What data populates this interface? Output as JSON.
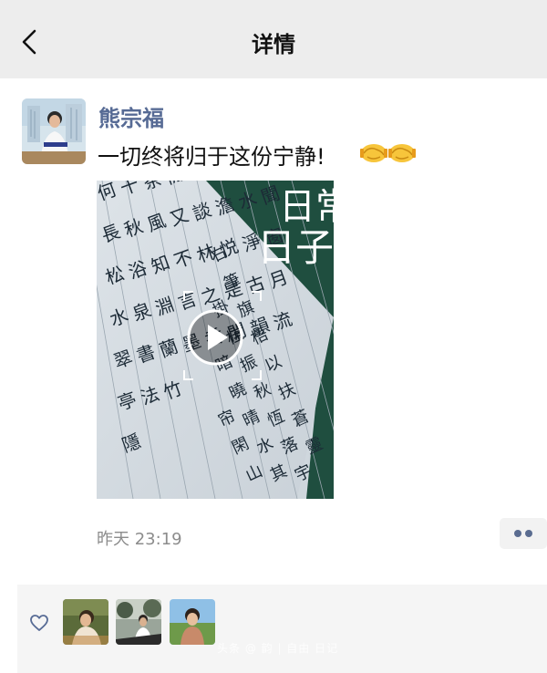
{
  "nav": {
    "title": "详情",
    "back_icon": "chevron-left-icon"
  },
  "post": {
    "username": "熊宗福",
    "text": "一切终将归于这份宁静!",
    "emoji": "handshake-emoji",
    "timestamp": "昨天 23:19",
    "video": {
      "overlay_title": "日常\n日子",
      "play_icon": "play-icon",
      "calligraphy_columns": [
        "何長松水翠亭隱",
        "十秋浴泉書法",
        "茶風知淵蘭竹",
        "閒又不言墨",
        "觀談林之香",
        "清澹悦是閒",
        "心水淨古韻",
        "時聞窗月流"
      ],
      "sheet_columns": [
        "右掛暗帘",
        "筆桂曉閑",
        "旗振晴山",
        "梧秋水天",
        "以恆其時",
        "扶落將美",
        "蒼宇夢松",
        "靈雁神"
      ]
    }
  },
  "colors": {
    "nav_bg": "#ededed",
    "username": "#576b95",
    "timestamp": "#8c8c8c",
    "likes_bg": "#f5f5f5",
    "video_green": "#1f4e3f"
  },
  "likes": {
    "heart_icon": "heart-outline-icon",
    "avatars": [
      "liker-avatar-1",
      "liker-avatar-2",
      "liker-avatar-3"
    ]
  },
  "watermark": "头条 @ 韵 | 自由 日记"
}
